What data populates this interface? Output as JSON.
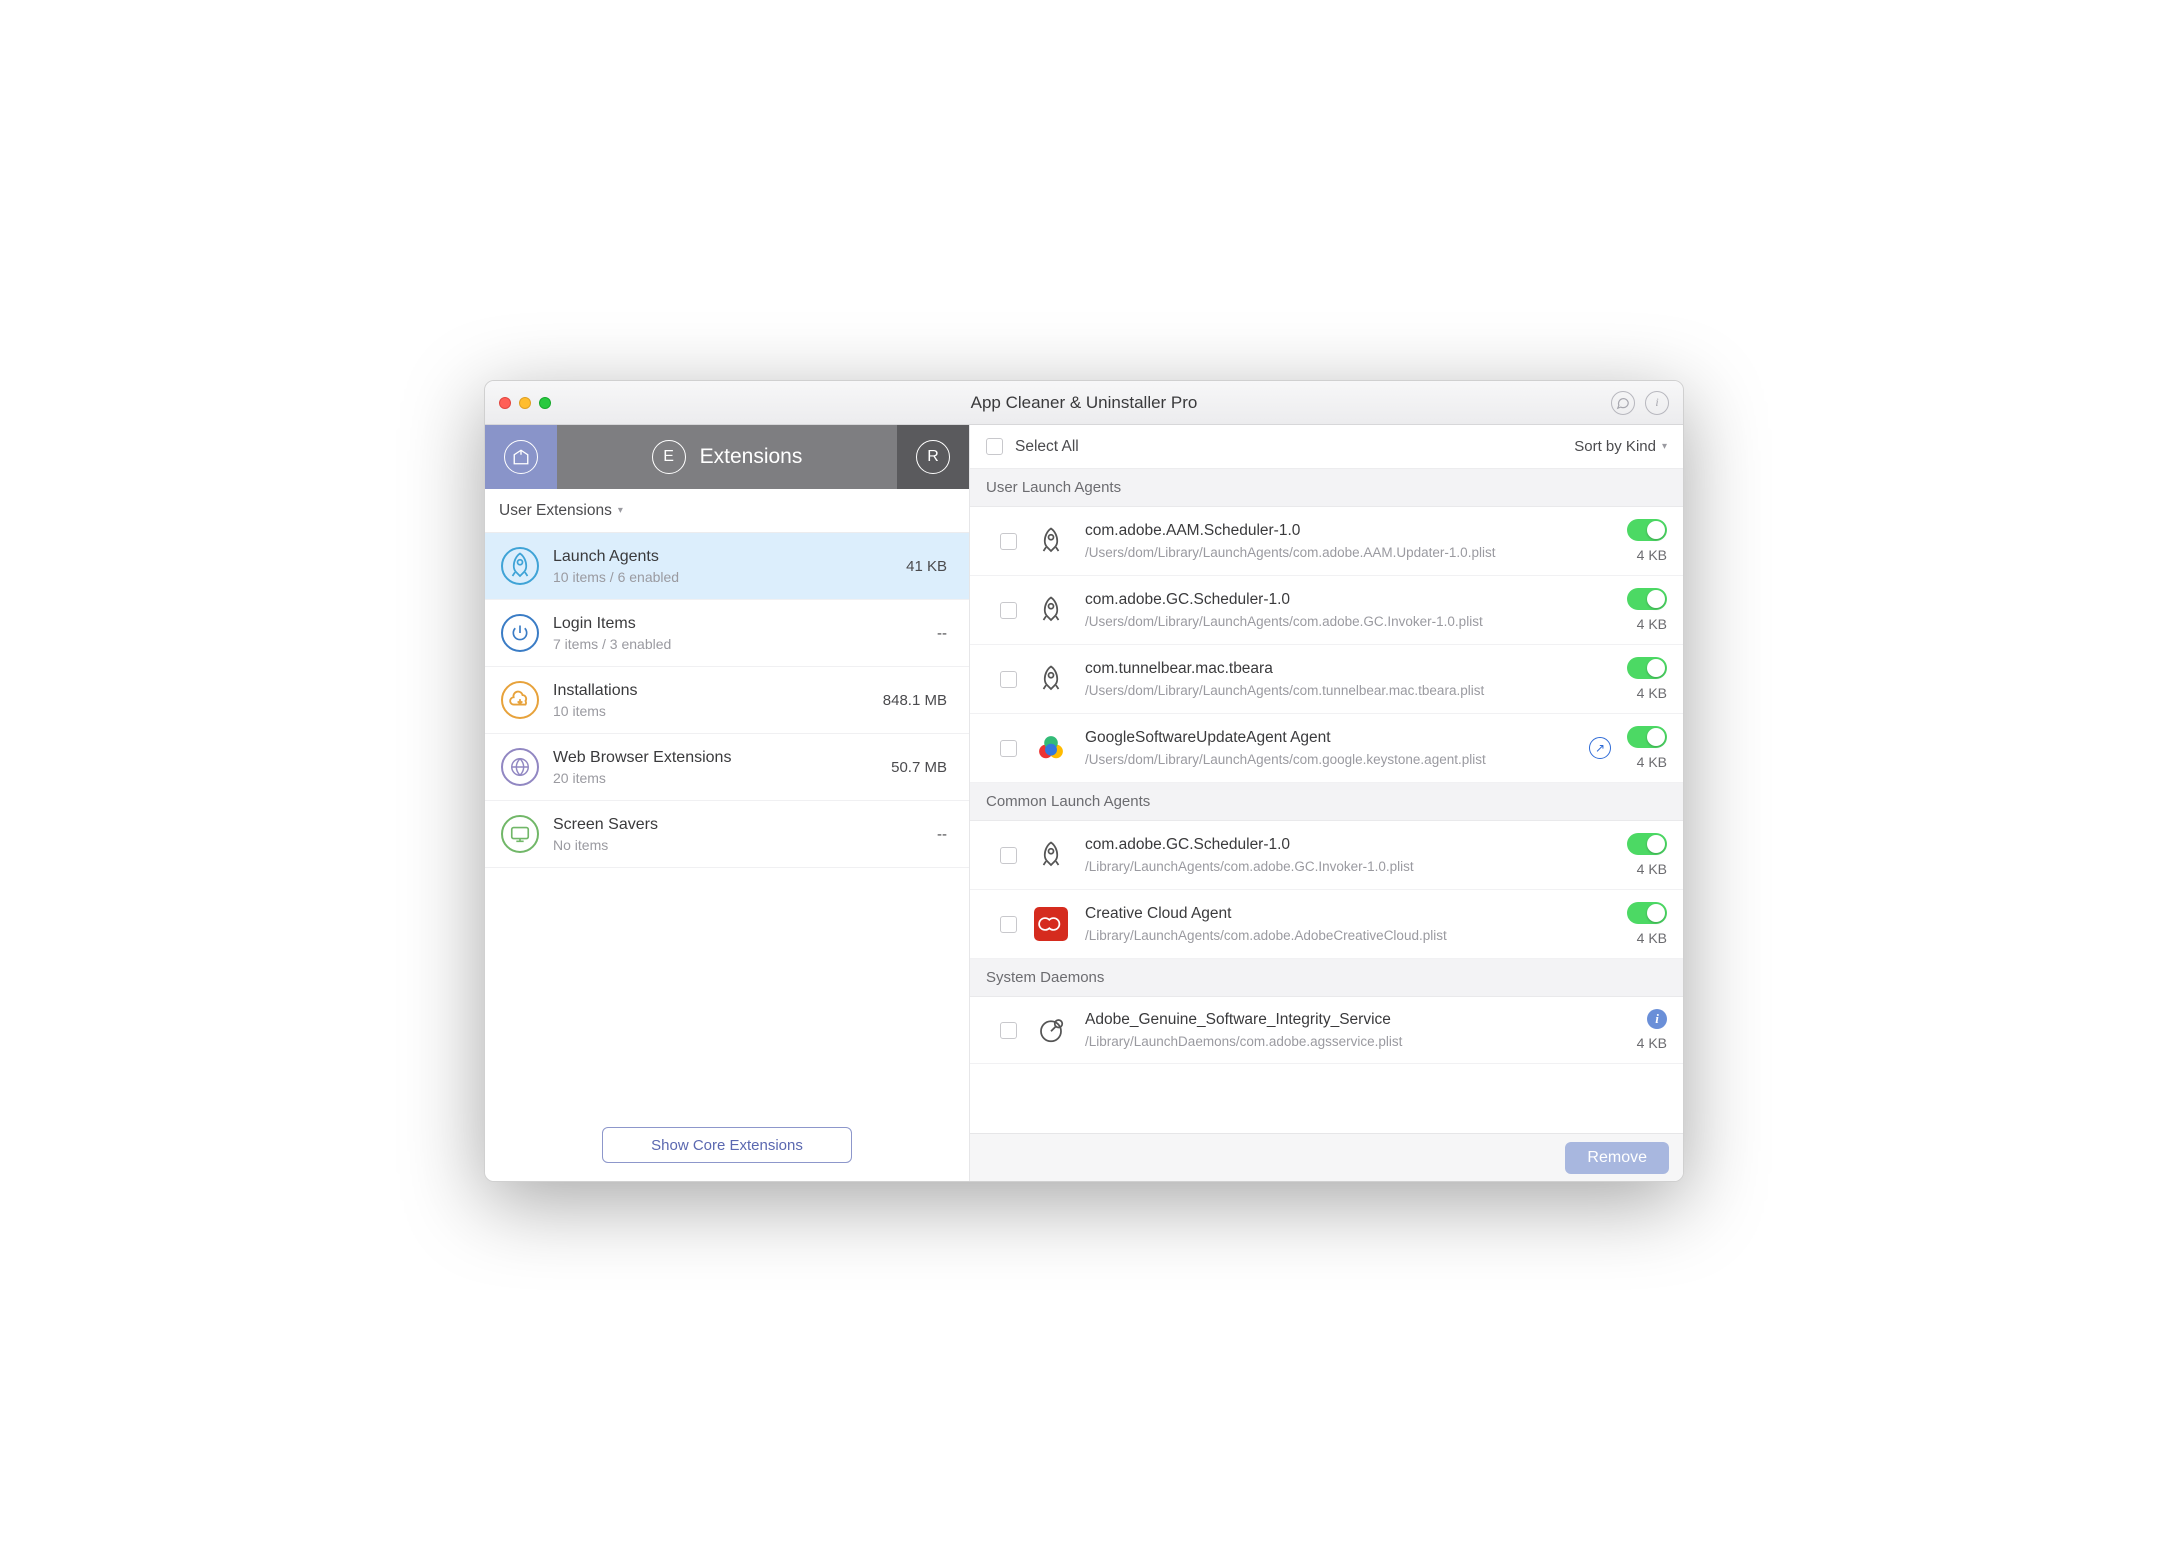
{
  "window": {
    "title": "App Cleaner & Uninstaller Pro"
  },
  "tabs": {
    "extensions_label": "Extensions"
  },
  "filter": {
    "label": "User Extensions"
  },
  "categories": [
    {
      "title": "Launch Agents",
      "sub": "10 items / 6 enabled",
      "size": "41 KB",
      "color": "#3fa3d6",
      "icon": "rocket"
    },
    {
      "title": "Login Items",
      "sub": "7 items / 3 enabled",
      "size": "--",
      "color": "#3a7cc5",
      "icon": "power"
    },
    {
      "title": "Installations",
      "sub": "10 items",
      "size": "848.1 MB",
      "color": "#e7a23b",
      "icon": "cloud-down"
    },
    {
      "title": "Web Browser Extensions",
      "sub": "20 items",
      "size": "50.7 MB",
      "color": "#9187c2",
      "icon": "globe"
    },
    {
      "title": "Screen Savers",
      "sub": "No items",
      "size": "--",
      "color": "#71b768",
      "icon": "screen"
    }
  ],
  "show_core_label": "Show Core Extensions",
  "right_controls": {
    "select_all": "Select All",
    "sort_label": "Sort by Kind"
  },
  "sections": [
    {
      "header": "User Launch Agents",
      "items": [
        {
          "title": "com.adobe.AAM.Scheduler-1.0",
          "path": "/Users/dom/Library/LaunchAgents/com.adobe.AAM.Updater-1.0.plist",
          "size": "4 KB",
          "icon": "rocket",
          "toggle": true
        },
        {
          "title": "com.adobe.GC.Scheduler-1.0",
          "path": "/Users/dom/Library/LaunchAgents/com.adobe.GC.Invoker-1.0.plist",
          "size": "4 KB",
          "icon": "rocket",
          "toggle": true
        },
        {
          "title": "com.tunnelbear.mac.tbeara",
          "path": "/Users/dom/Library/LaunchAgents/com.tunnelbear.mac.tbeara.plist",
          "size": "4 KB",
          "icon": "rocket",
          "toggle": true
        },
        {
          "title": "GoogleSoftwareUpdateAgent Agent",
          "path": "/Users/dom/Library/LaunchAgents/com.google.keystone.agent.plist",
          "size": "4 KB",
          "icon": "google",
          "toggle": true,
          "reveal": true
        }
      ]
    },
    {
      "header": "Common Launch Agents",
      "items": [
        {
          "title": "com.adobe.GC.Scheduler-1.0",
          "path": "/Library/LaunchAgents/com.adobe.GC.Invoker-1.0.plist",
          "size": "4 KB",
          "icon": "rocket",
          "toggle": true
        },
        {
          "title": "Creative Cloud Agent",
          "path": "/Library/LaunchAgents/com.adobe.AdobeCreativeCloud.plist",
          "size": "4 KB",
          "icon": "adobe-cc",
          "toggle": true
        }
      ]
    },
    {
      "header": "System Daemons",
      "items": [
        {
          "title": "Adobe_Genuine_Software_Integrity_Service",
          "path": "/Library/LaunchDaemons/com.adobe.agsservice.plist",
          "size": "4 KB",
          "icon": "gauge",
          "info": true
        }
      ]
    }
  ],
  "footer": {
    "remove_label": "Remove"
  }
}
